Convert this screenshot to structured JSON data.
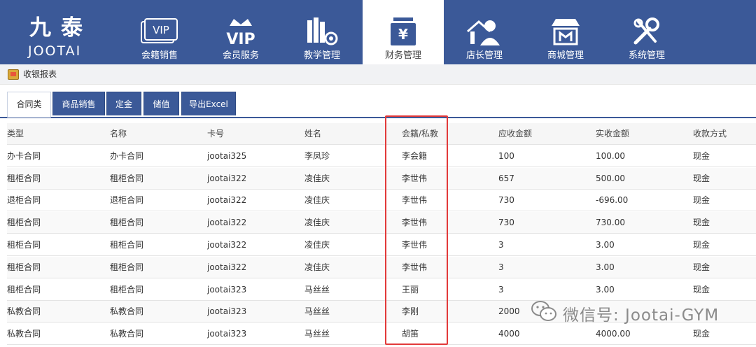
{
  "logo": {
    "cn": "九泰",
    "en": "JOOTAI"
  },
  "nav": [
    {
      "label": "会籍销售",
      "icon": "vip-card-icon"
    },
    {
      "label": "会员服务",
      "icon": "vip-crown-icon"
    },
    {
      "label": "教学管理",
      "icon": "teaching-icon"
    },
    {
      "label": "财务管理",
      "icon": "finance-yen-icon",
      "active": true
    },
    {
      "label": "店长管理",
      "icon": "manager-icon"
    },
    {
      "label": "商城管理",
      "icon": "shop-icon"
    },
    {
      "label": "系统管理",
      "icon": "tools-icon"
    }
  ],
  "subheader": {
    "title": "收银报表"
  },
  "tabs": [
    {
      "label": "合同类",
      "active": true
    },
    {
      "label": "商品销售"
    },
    {
      "label": "定金"
    },
    {
      "label": "储值"
    },
    {
      "label": "导出Excel"
    }
  ],
  "table": {
    "headers": [
      "类型",
      "名称",
      "卡号",
      "姓名",
      "会籍/私教",
      "应收金额",
      "实收金额",
      "收款方式"
    ],
    "rows": [
      [
        "办卡合同",
        "办卡合同",
        "jootai325",
        "李凤珍",
        "李会籍",
        "100",
        "100.00",
        "现金"
      ],
      [
        "租柜合同",
        "租柜合同",
        "jootai322",
        "凌佳庆",
        "李世伟",
        "657",
        "500.00",
        "现金"
      ],
      [
        "退柜合同",
        "退柜合同",
        "jootai322",
        "凌佳庆",
        "李世伟",
        "730",
        "-696.00",
        "现金"
      ],
      [
        "租柜合同",
        "租柜合同",
        "jootai322",
        "凌佳庆",
        "李世伟",
        "730",
        "730.00",
        "现金"
      ],
      [
        "租柜合同",
        "租柜合同",
        "jootai322",
        "凌佳庆",
        "李世伟",
        "3",
        "3.00",
        "现金"
      ],
      [
        "租柜合同",
        "租柜合同",
        "jootai322",
        "凌佳庆",
        "李世伟",
        "3",
        "3.00",
        "现金"
      ],
      [
        "租柜合同",
        "租柜合同",
        "jootai323",
        "马丝丝",
        "王丽",
        "3",
        "3.00",
        "现金"
      ],
      [
        "私教合同",
        "私教合同",
        "jootai323",
        "马丝丝",
        "李刚",
        "2000",
        "",
        ""
      ],
      [
        "私教合同",
        "私教合同",
        "jootai323",
        "马丝丝",
        "胡笛",
        "4000",
        "4000.00",
        "现金"
      ]
    ]
  },
  "watermark": {
    "text": "微信号: Jootai-GYM"
  },
  "colors": {
    "nav_bg": "#3b5998",
    "highlight": "#e23a3a"
  }
}
